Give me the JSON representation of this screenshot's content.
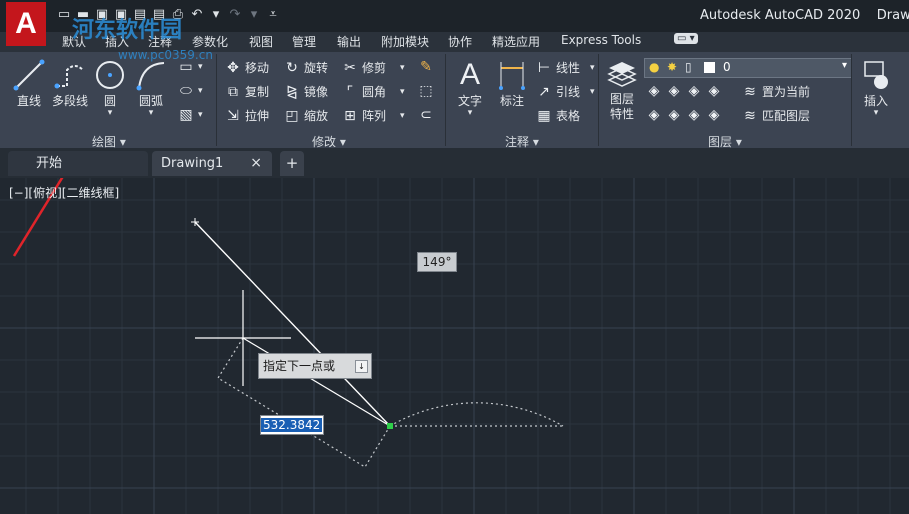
{
  "logo": {
    "letter": "A"
  },
  "watermark": {
    "text": "河东软件园",
    "url": "www.pc0359.cn"
  },
  "title": {
    "app": "Autodesk AutoCAD 2020",
    "doc": "Drawing"
  },
  "qat": {
    "items": [
      "新建",
      "打开",
      "保存",
      "另存为",
      "从Web打开",
      "保存到Web",
      "打印",
      "放弃",
      "重做",
      "更多"
    ]
  },
  "menu": [
    "默认",
    "插入",
    "注释",
    "参数化",
    "视图",
    "管理",
    "输出",
    "附加模块",
    "协作",
    "精选应用",
    "Express Tools"
  ],
  "draw_panel": {
    "title": "绘图",
    "line": "直线",
    "polyline": "多段线",
    "circle": "圆",
    "arc": "圆弧"
  },
  "modify_panel": {
    "title": "修改",
    "move": "移动",
    "rotate": "旋转",
    "trim": "修剪",
    "copy": "复制",
    "mirror": "镜像",
    "fillet": "圆角",
    "stretch": "拉伸",
    "scale": "缩放",
    "array": "阵列"
  },
  "annotation_panel": {
    "title": "注释",
    "text": "文字",
    "dimension": "标注",
    "linear": "线性",
    "leader": "引线",
    "table": "表格"
  },
  "layers_panel": {
    "title": "图层",
    "properties": "图层\n特性",
    "properties_l1": "图层",
    "properties_l2": "特性",
    "current_layer": "0",
    "set_current": "置为当前",
    "match_layer": "匹配图层"
  },
  "insert_panel": {
    "insert": "插入"
  },
  "tabs": {
    "start": "开始",
    "drawing": "Drawing1",
    "close": "×",
    "new": "+"
  },
  "viewport": {
    "label": "[−][俯视][二维线框]"
  },
  "dynamic_input": {
    "angle": "149°",
    "prompt": "指定下一点或",
    "distance": "532.3842"
  },
  "colors": {
    "accent": "#1a5fb4",
    "logo_red": "#c4161c",
    "arrow_red": "#e0242a",
    "canvas": "#212830",
    "ribbon": "#3c4452"
  }
}
